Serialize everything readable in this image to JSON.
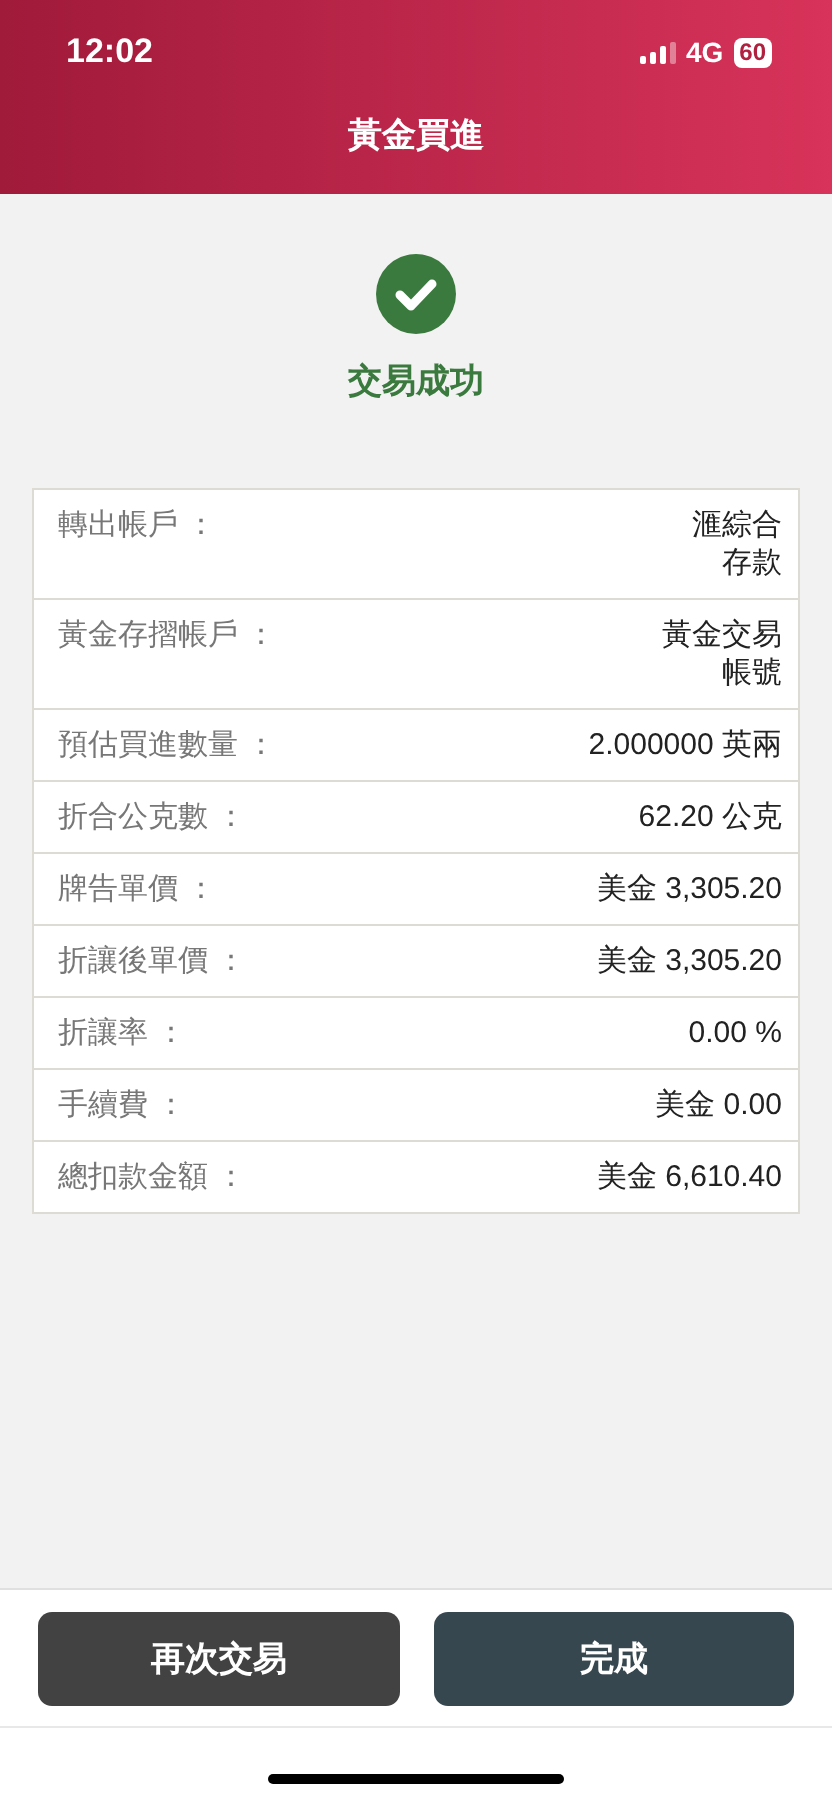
{
  "status_bar": {
    "time": "12:02",
    "network": "4G",
    "battery": "60"
  },
  "header": {
    "title": "黃金買進"
  },
  "result": {
    "message": "交易成功"
  },
  "details": [
    {
      "label": "轉出帳戶 ：",
      "value_lines": [
        "滙綜合",
        "存款"
      ]
    },
    {
      "label": "黃金存摺帳戶 ：",
      "value_lines": [
        "黃金交易",
        "帳號"
      ]
    },
    {
      "label": "預估買進數量 ：",
      "value_lines": [
        "2.000000 英兩"
      ]
    },
    {
      "label": "折合公克數 ：",
      "value_lines": [
        "62.20 公克"
      ]
    },
    {
      "label": "牌告單價 ：",
      "value_lines": [
        "美金 3,305.20"
      ]
    },
    {
      "label": "折讓後單價 ：",
      "value_lines": [
        "美金 3,305.20"
      ]
    },
    {
      "label": "折讓率 ：",
      "value_lines": [
        "0.00 %"
      ]
    },
    {
      "label": "手續費 ：",
      "value_lines": [
        "美金 0.00"
      ]
    },
    {
      "label": "總扣款金額 ：",
      "value_lines": [
        "美金 6,610.40"
      ]
    }
  ],
  "buttons": [
    {
      "label": "再次交易",
      "kind": "secondary"
    },
    {
      "label": "完成",
      "kind": "primary"
    }
  ]
}
